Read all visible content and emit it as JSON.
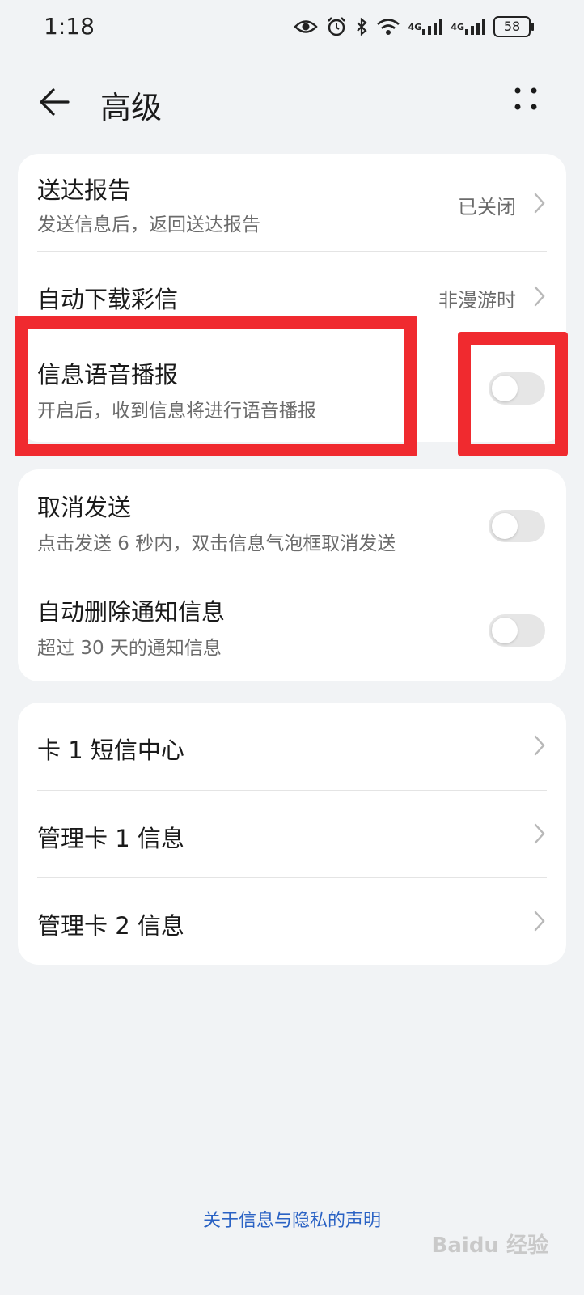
{
  "status_bar": {
    "time": "1:18",
    "sig1_label": "4G",
    "sig2_label": "4G",
    "battery": "58",
    "icons": [
      "eye-icon",
      "alarm-icon",
      "bluetooth-icon",
      "wifi-icon",
      "signal-icon",
      "signal-icon",
      "battery-icon"
    ]
  },
  "header": {
    "title": "高级"
  },
  "group1": {
    "delivery_report": {
      "title": "送达报告",
      "subtitle": "发送信息后，返回送达报告",
      "value": "已关闭"
    },
    "auto_download_mms": {
      "title": "自动下载彩信",
      "value": "非漫游时"
    },
    "voice_broadcast": {
      "title": "信息语音播报",
      "subtitle": "开启后，收到信息将进行语音播报",
      "enabled": false
    }
  },
  "group2": {
    "cancel_send": {
      "title": "取消发送",
      "subtitle": "点击发送 6 秒内，双击信息气泡框取消发送",
      "enabled": false
    },
    "auto_delete_notifications": {
      "title": "自动删除通知信息",
      "subtitle": "超过 30 天的通知信息",
      "enabled": false
    }
  },
  "group3": {
    "items": [
      {
        "title": "卡 1 短信中心"
      },
      {
        "title": "管理卡 1 信息"
      },
      {
        "title": "管理卡 2 信息"
      }
    ]
  },
  "footer": {
    "privacy_link": "关于信息与隐私的声明",
    "watermark": "Baidu 经验"
  },
  "colors": {
    "background": "#f1f3f5",
    "card": "#ffffff",
    "highlight": "#f02a2f",
    "link": "#2a62c4",
    "toggle_off": "#e6e6e6"
  }
}
